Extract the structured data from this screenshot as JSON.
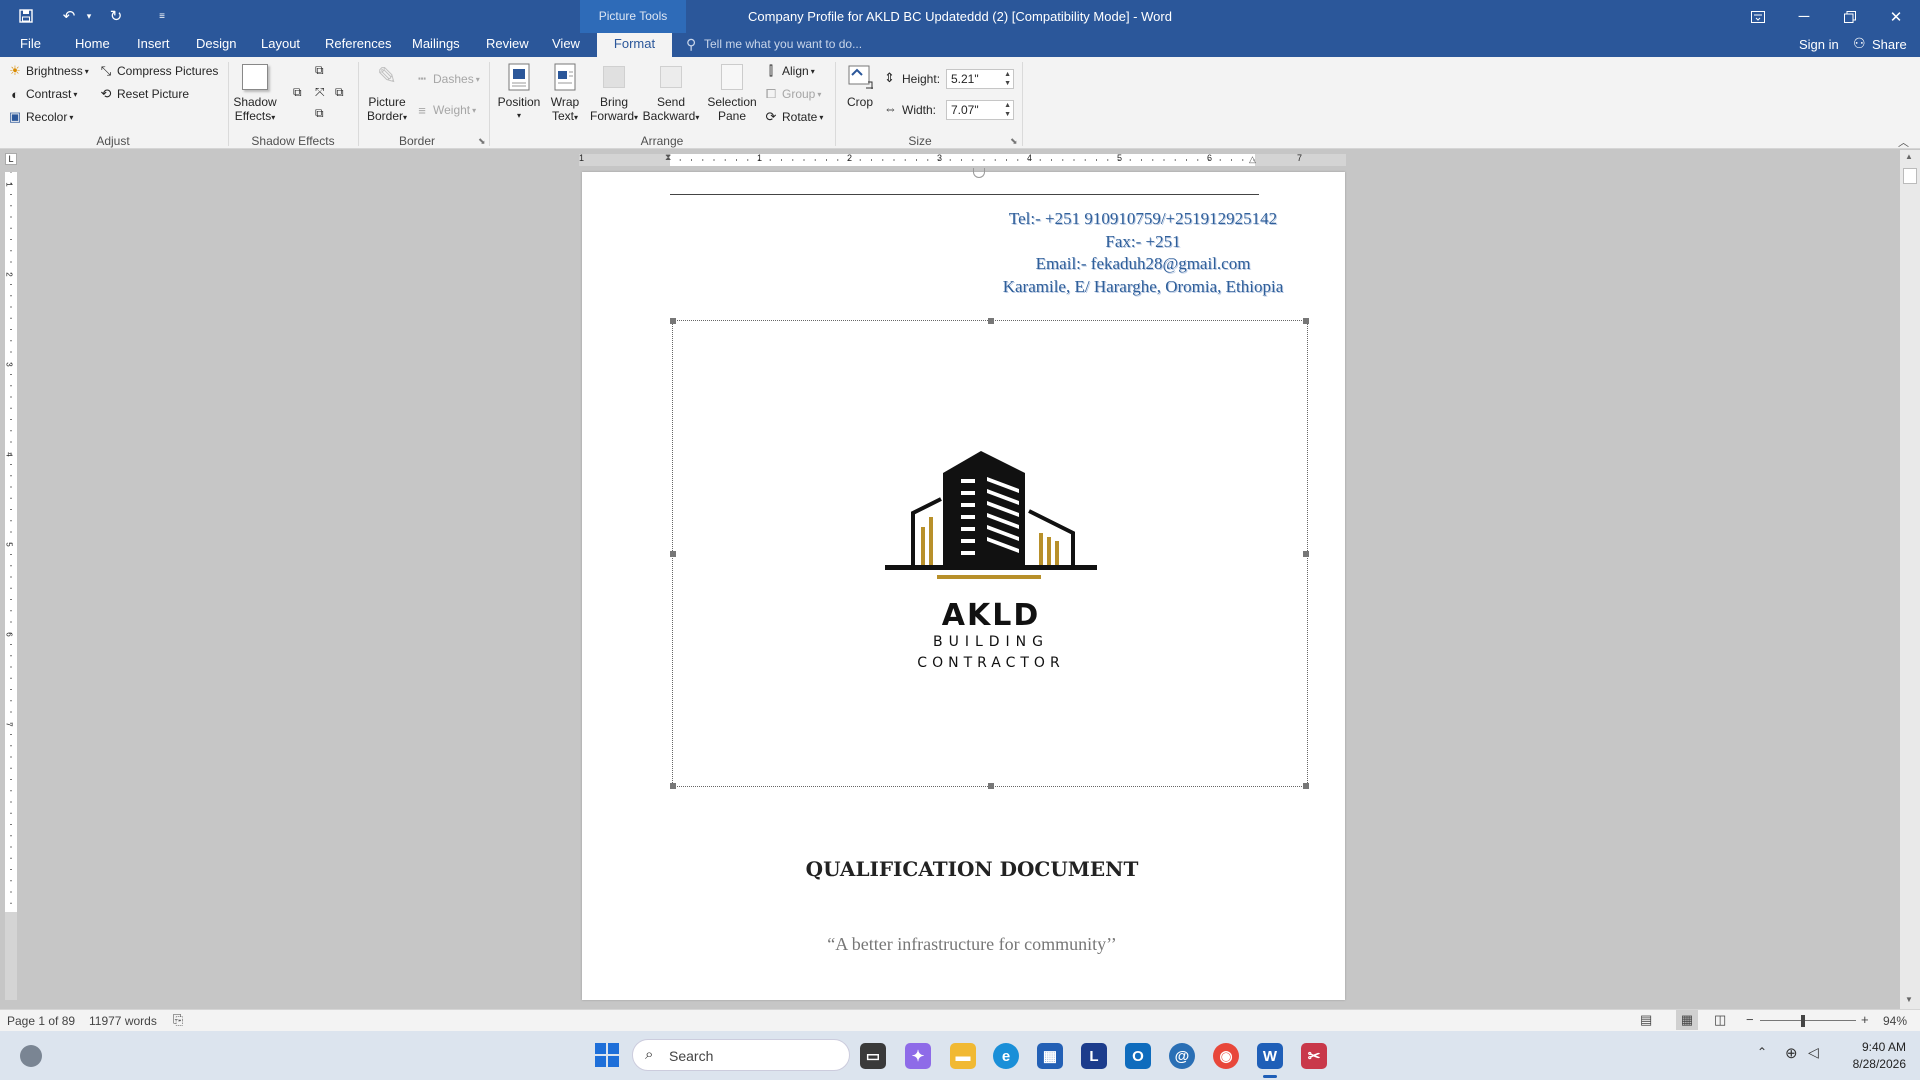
{
  "window": {
    "title": "Company Profile for AKLD BC Updateddd (2) [Compatibility Mode] - Word",
    "context_tab_group": "Picture Tools",
    "controls": [
      "ribbon-display-options",
      "minimize",
      "restore",
      "close"
    ]
  },
  "tabs": {
    "file": "File",
    "home": "Home",
    "insert": "Insert",
    "design": "Design",
    "layout": "Layout",
    "references": "References",
    "mailings": "Mailings",
    "review": "Review",
    "view": "View",
    "format": "Format",
    "tell_me": "Tell me what you want to do...",
    "sign_in": "Sign in",
    "share": "Share"
  },
  "ribbon": {
    "adjust": {
      "label": "Adjust",
      "brightness": "Brightness",
      "contrast": "Contrast",
      "recolor": "Recolor",
      "compress": "Compress Pictures",
      "reset": "Reset Picture"
    },
    "shadow": {
      "label": "Shadow Effects",
      "shadow_effects_1": "Shadow",
      "shadow_effects_2": "Effects"
    },
    "border": {
      "label": "Border",
      "dashes": "Dashes",
      "weight": "Weight",
      "picture_border_1": "Picture",
      "picture_border_2": "Border"
    },
    "arrange": {
      "label": "Arrange",
      "position": "Position",
      "wrap_1": "Wrap",
      "wrap_2": "Text",
      "bring_1": "Bring",
      "bring_2": "Forward",
      "send_1": "Send",
      "send_2": "Backward",
      "selection_1": "Selection",
      "selection_2": "Pane",
      "align": "Align",
      "group": "Group",
      "rotate": "Rotate"
    },
    "size": {
      "label": "Size",
      "crop": "Crop",
      "height_label": "Height:",
      "height_value": "5.21\"",
      "width_label": "Width:",
      "width_value": "7.07\""
    }
  },
  "ruler": {
    "numbers": [
      "1",
      "1",
      "2",
      "3",
      "4",
      "5",
      "6",
      "7"
    ],
    "vnumbers": [
      "1",
      "2",
      "3",
      "4",
      "5",
      "6",
      "7"
    ]
  },
  "document": {
    "contact": {
      "tel": "Tel:- +251 910910759/+251912925142",
      "fax": "Fax:- +251",
      "email": "Email:- fekaduh28@gmail.com",
      "address": "Karamile, E/ Hararghe, Oromia, Ethiopia"
    },
    "logo": {
      "name": "AKLD",
      "line2": "BUILDING",
      "line3": "CONTRACTOR",
      "colors": {
        "dark": "#111111",
        "gold": "#b8902a"
      }
    },
    "heading": "QUALIFICATION DOCUMENT",
    "tagline": "“A better infrastructure for community’’"
  },
  "status": {
    "page": "Page 1 of 89",
    "words": "11977 words",
    "zoom": "94%"
  },
  "taskbar": {
    "search": "Search",
    "time": "9:40 AM",
    "date": "8/28/2026"
  },
  "colors": {
    "accent": "#2b579a",
    "contact_text": "#2f5f9a"
  }
}
